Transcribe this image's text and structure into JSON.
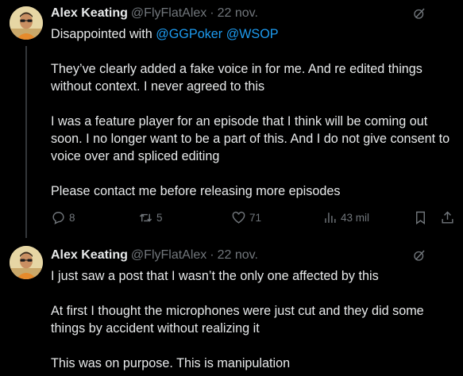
{
  "tweets": [
    {
      "author": {
        "display_name": "Alex Keating",
        "handle": "@FlyFlatAlex",
        "separator": "·",
        "date": "22 nov."
      },
      "body": {
        "line1_prefix": "Disappointed with ",
        "mention1": "@GGPoker",
        "mention2": "@WSOP",
        "para2": "They’ve clearly added a fake voice in for me. And re edited things without context. I never agreed to this",
        "para3": "I was a feature player for an episode that I think will be coming out soon. I no longer want to be a part of this. And I do not give consent to voice over and spliced editing",
        "para4": "Please contact me before releasing more episodes"
      },
      "actions": {
        "replies": "8",
        "reposts": "5",
        "likes": "71",
        "views": "43 mil"
      }
    },
    {
      "author": {
        "display_name": "Alex Keating",
        "handle": "@FlyFlatAlex",
        "separator": "·",
        "date": "22 nov."
      },
      "body": {
        "para1": "I just saw a post that I wasn’t the only one affected by this",
        "para2": "At first I thought the microphones were just cut and they did some things by accident without realizing it",
        "para3": "This was on purpose. This is manipulation"
      }
    }
  ],
  "colors": {
    "background": "#000000",
    "text_primary": "#e7e9ea",
    "text_secondary": "#71767b",
    "link": "#1d9bf0",
    "thread_line": "#333639"
  },
  "icons": {
    "grok": "grok-icon",
    "reply": "reply-icon",
    "repost": "repost-icon",
    "like": "like-icon",
    "views": "views-icon",
    "bookmark": "bookmark-icon",
    "share": "share-icon"
  }
}
